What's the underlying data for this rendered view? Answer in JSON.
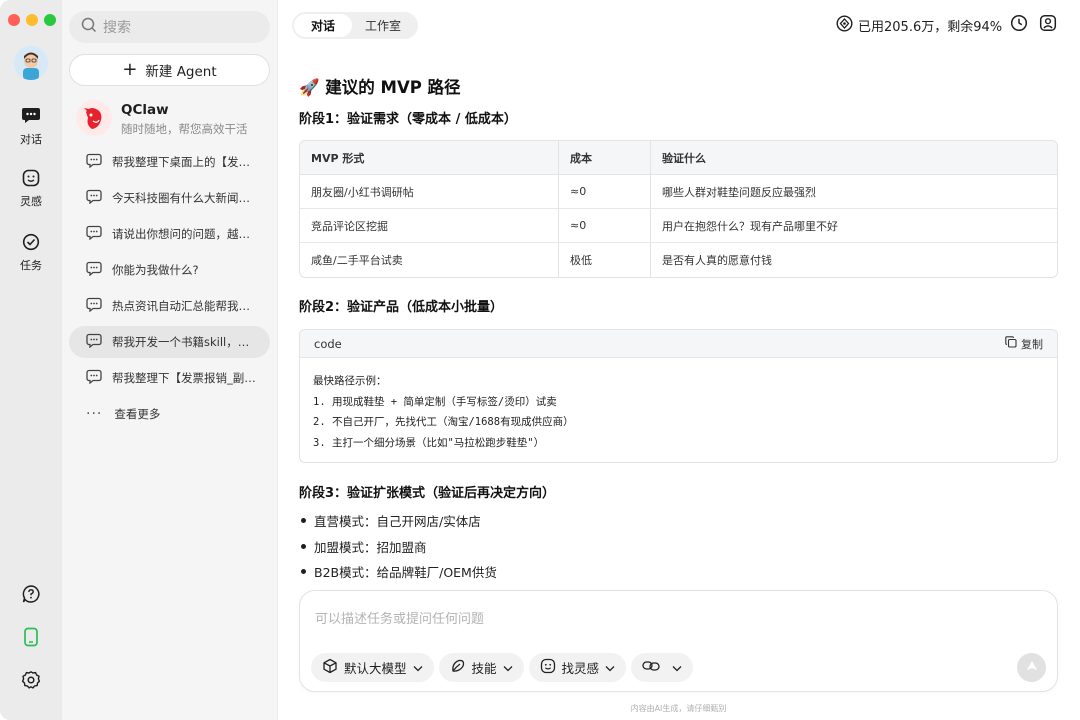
{
  "rail": {
    "items": [
      {
        "label": "对话",
        "icon": "chat-bubble-icon"
      },
      {
        "label": "灵感",
        "icon": "smile-icon"
      },
      {
        "label": "任务",
        "icon": "check-circle-icon"
      }
    ]
  },
  "sidebar": {
    "search_placeholder": "搜索",
    "new_agent_label": "新建 Agent",
    "agent": {
      "name": "QClaw",
      "description": "随时随地，帮您高效干活"
    },
    "chats": [
      "帮我整理下桌面上的【发票报销_副本】文件夹",
      "今天科技圈有什么大新闻，帮我总结一下",
      "请说出你想问的问题，越具体越好",
      "你能为我做什么?",
      "热点资讯自动汇总能帮我做吗",
      "帮我开发一个书籍skill，能帮我整理读书笔记",
      "帮我整理下【发票报销_副本】文件夹"
    ],
    "active_index": 5,
    "more_label": "查看更多"
  },
  "topbar": {
    "tabs": [
      "对话",
      "工作室"
    ],
    "usage_text": "已用205.6万，剩余94%"
  },
  "content": {
    "title": "🚀 建议的 MVP 路径",
    "stage1_title": "阶段1：验证需求（零成本 / 低成本）",
    "table": {
      "headers": [
        "MVP 形式",
        "成本",
        "验证什么"
      ],
      "rows": [
        [
          "朋友圈/小红书调研帖",
          "≈0",
          "哪些人群对鞋垫问题反应最强烈"
        ],
        [
          "竞品评论区挖掘",
          "≈0",
          "用户在抱怨什么？现有产品哪里不好"
        ],
        [
          "咸鱼/二手平台试卖",
          "极低",
          "是否有人真的愿意付钱"
        ]
      ]
    },
    "stage2_title": "阶段2：验证产品（低成本小批量）",
    "code": {
      "lang": "code",
      "copy_label": "复制",
      "text": "最快路径示例：\n1. 用现成鞋垫 + 简单定制（手写标签/烫印）试卖\n2. 不自己开厂，先找代工（淘宝/1688有现成供应商）\n3. 主打一个细分场景（比如\"马拉松跑步鞋垫\"）"
    },
    "stage3_title": "阶段3：验证扩张模式（验证后再决定方向）",
    "bullets": [
      "直营模式：自己开网店/实体店",
      "加盟模式：招加盟商",
      "B2B模式：给品牌鞋厂/OEM供货"
    ]
  },
  "composer": {
    "placeholder": "可以描述任务或提问任何问题",
    "pills": [
      {
        "label": "默认大模型",
        "icon": "cube-icon"
      },
      {
        "label": "技能",
        "icon": "leaf-icon"
      },
      {
        "label": "找灵感",
        "icon": "smile-icon"
      },
      {
        "label": "",
        "icon": "link-icon"
      }
    ]
  },
  "footer_note": "内容由AI生成，请仔细甄别",
  "colors": {
    "accent_green": "#2bbd56",
    "traffic_red": "#ff5f57",
    "traffic_yellow": "#febc2e",
    "traffic_green": "#28c840"
  }
}
